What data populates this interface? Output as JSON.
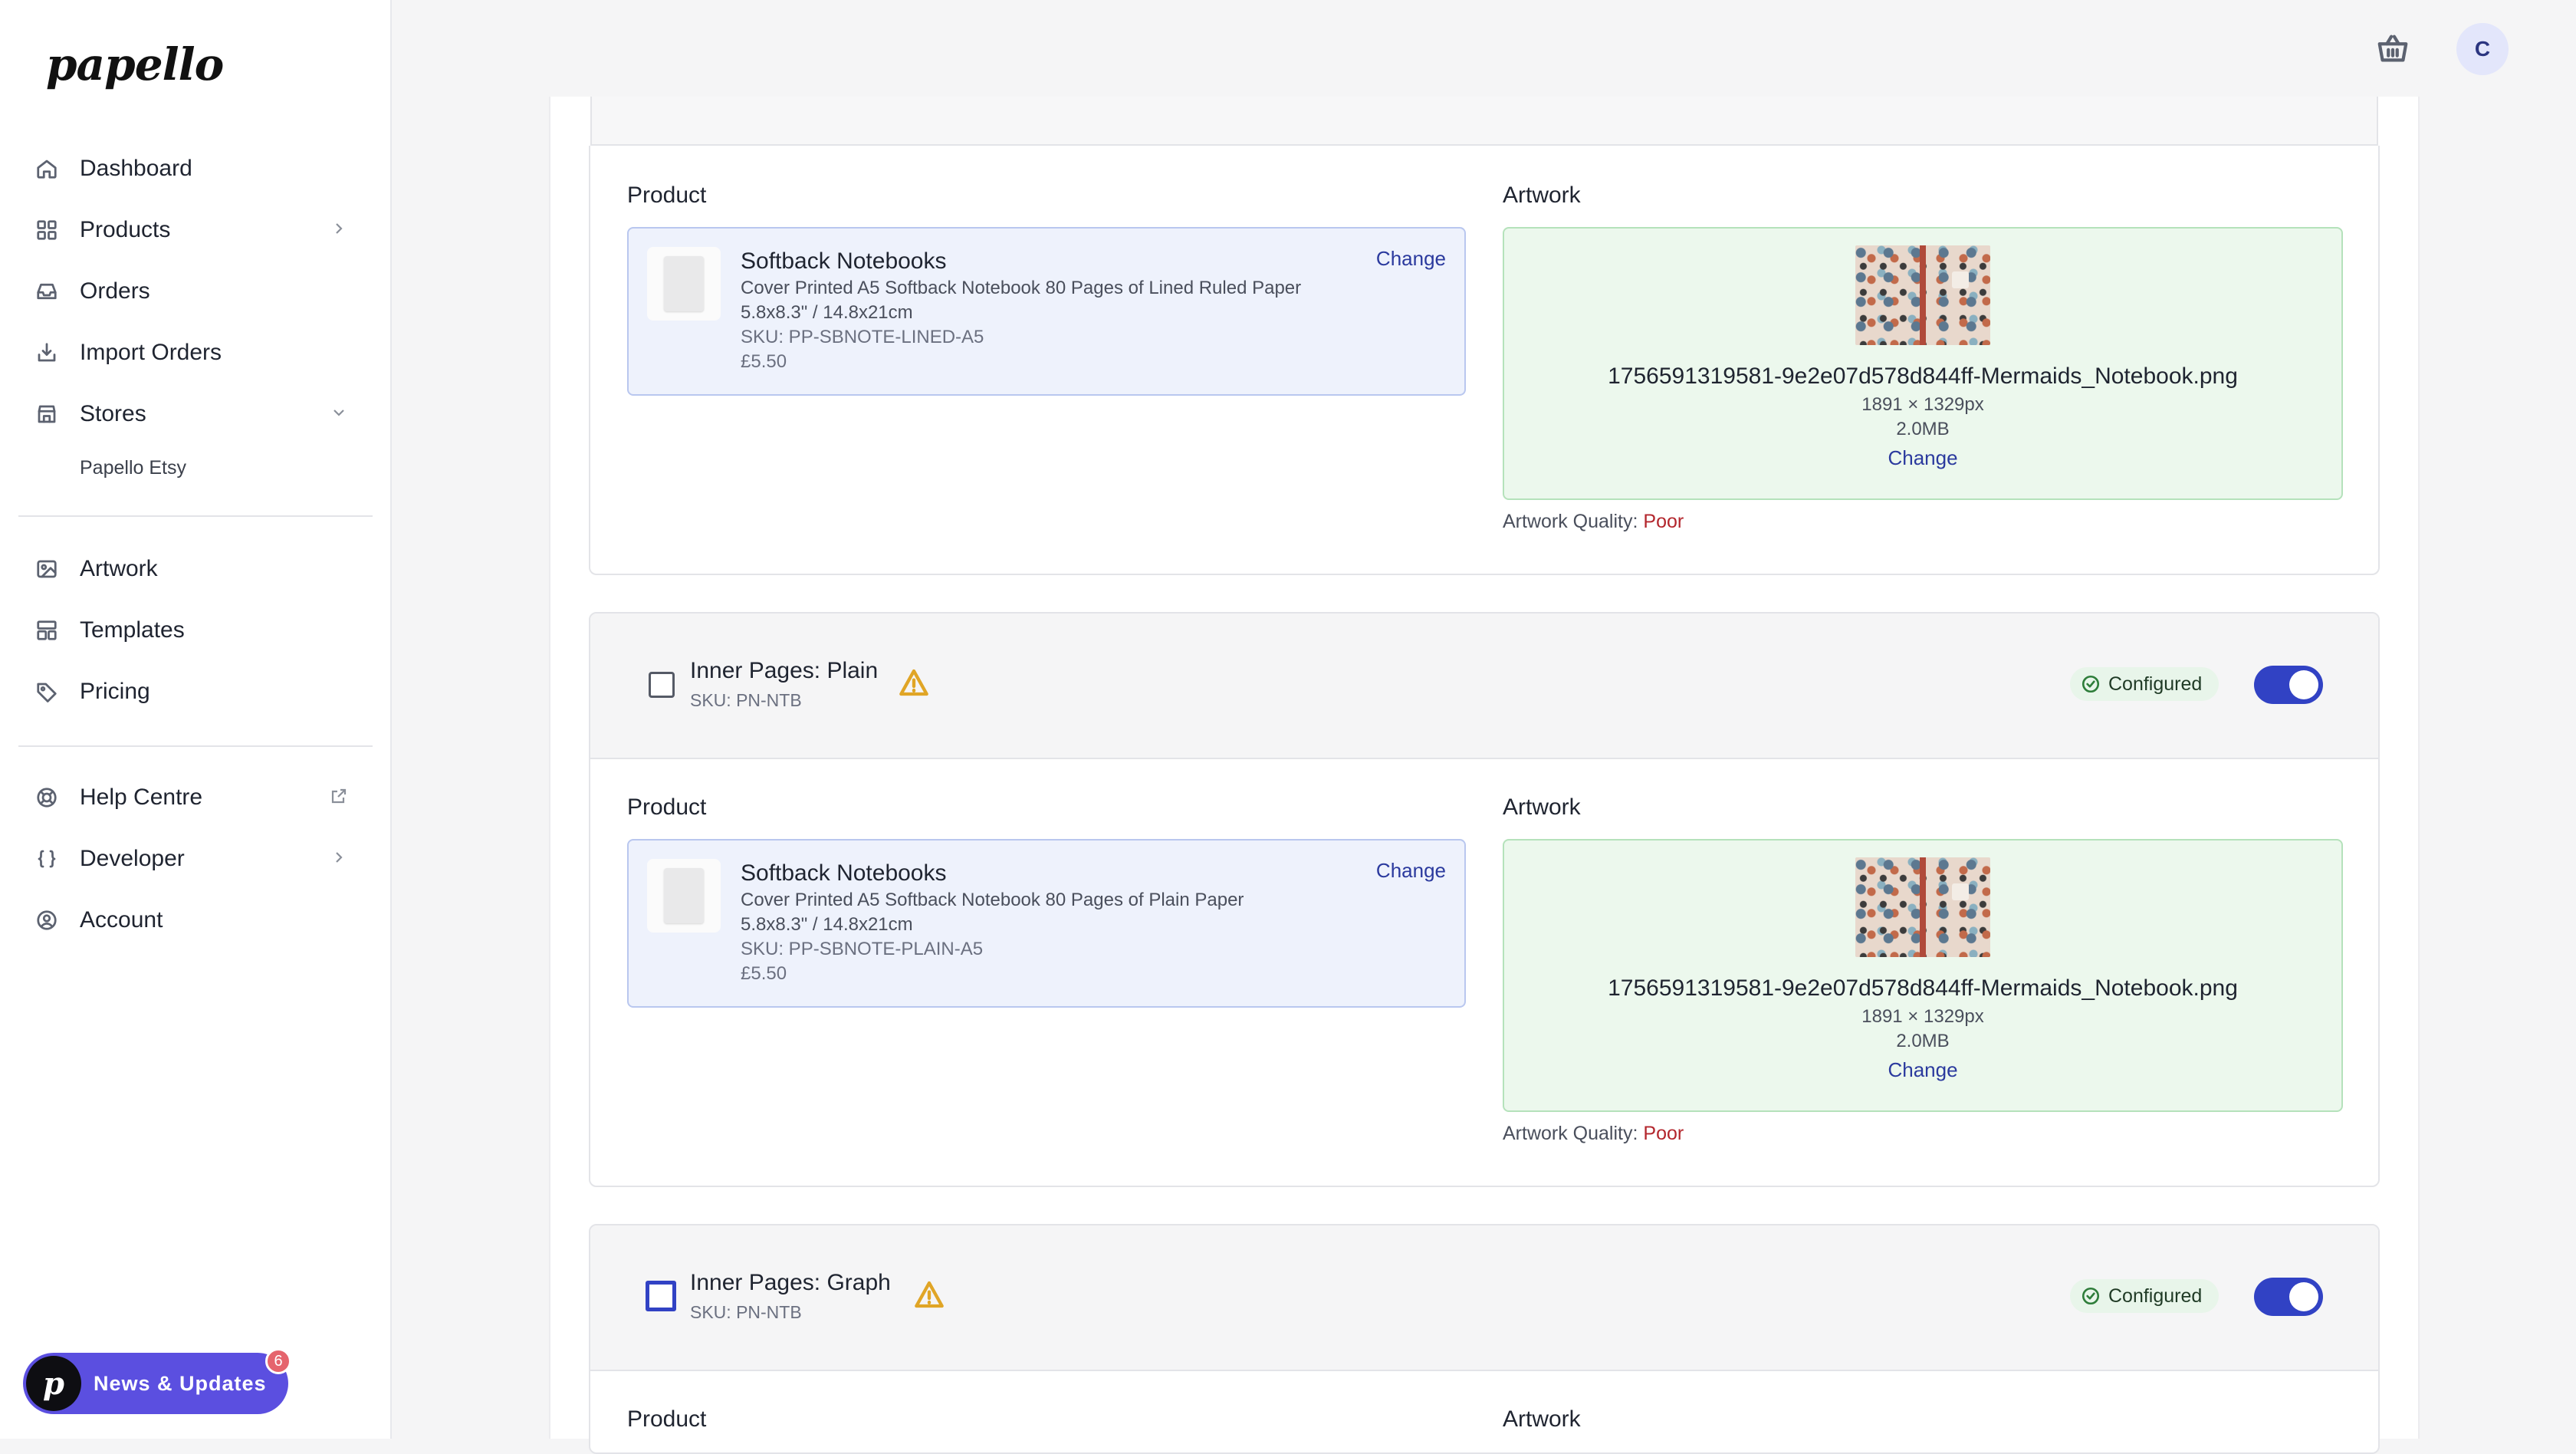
{
  "brand": {
    "logo_text": "papello",
    "accent": "#3142c4"
  },
  "sidebar": {
    "items": [
      {
        "label": "Dashboard",
        "icon": "home-icon"
      },
      {
        "label": "Products",
        "icon": "grid-icon"
      },
      {
        "label": "Orders",
        "icon": "inbox-icon"
      },
      {
        "label": "Import Orders",
        "icon": "import-icon"
      },
      {
        "label": "Stores",
        "icon": "store-icon"
      },
      {
        "label": "Artwork",
        "icon": "image-icon"
      },
      {
        "label": "Templates",
        "icon": "template-icon"
      },
      {
        "label": "Pricing",
        "icon": "tag-icon"
      },
      {
        "label": "Help Centre",
        "icon": "lifebuoy-icon"
      },
      {
        "label": "Developer",
        "icon": "braces-icon"
      },
      {
        "label": "Account",
        "icon": "user-circle-icon"
      }
    ],
    "store_sub": "Papello Etsy",
    "news": {
      "label": "News & Updates",
      "badge": "6"
    }
  },
  "header": {
    "avatar_initial": "C"
  },
  "top_card": {
    "product_label": "Product",
    "artwork_label": "Artwork",
    "product": {
      "name": "Softback Notebooks",
      "desc": "Cover Printed A5 Softback Notebook 80 Pages of Lined Ruled Paper",
      "size": "5.8x8.3\" / 14.8x21cm",
      "sku": "SKU: PP-SBNOTE-LINED-A5",
      "price": "£5.50",
      "change": "Change"
    },
    "artwork": {
      "filename": "1756591319581-9e2e07d578d844ff-Mermaids_Notebook.png",
      "dims": "1891 × 1329px",
      "size": "2.0MB",
      "change": "Change"
    },
    "quality_label": "Artwork Quality:",
    "quality_value": "Poor"
  },
  "card_plain": {
    "title": "Inner Pages: Plain",
    "sku": "SKU: PN-NTB",
    "status": "Configured",
    "product_label": "Product",
    "artwork_label": "Artwork",
    "product": {
      "name": "Softback Notebooks",
      "desc": "Cover Printed A5 Softback Notebook 80 Pages of Plain Paper",
      "size": "5.8x8.3\" / 14.8x21cm",
      "sku": "SKU: PP-SBNOTE-PLAIN-A5",
      "price": "£5.50",
      "change": "Change"
    },
    "artwork": {
      "filename": "1756591319581-9e2e07d578d844ff-Mermaids_Notebook.png",
      "dims": "1891 × 1329px",
      "size": "2.0MB",
      "change": "Change"
    },
    "quality_label": "Artwork Quality:",
    "quality_value": "Poor"
  },
  "card_graph": {
    "title": "Inner Pages: Graph",
    "sku": "SKU: PN-NTB",
    "status": "Configured",
    "product_label": "Product",
    "artwork_label": "Artwork"
  }
}
